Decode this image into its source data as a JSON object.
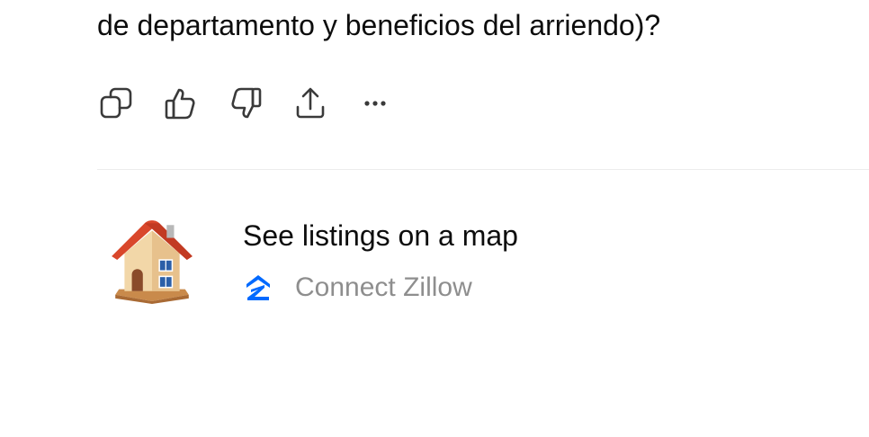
{
  "message": {
    "text": "de departamento y beneficios del arriendo)?"
  },
  "actions": [
    {
      "name": "copy",
      "icon": "copy-icon"
    },
    {
      "name": "thumbs-up",
      "icon": "thumbs-up-icon"
    },
    {
      "name": "thumbs-down",
      "icon": "thumbs-down-icon"
    },
    {
      "name": "share",
      "icon": "share-icon"
    },
    {
      "name": "more",
      "icon": "more-icon"
    }
  ],
  "card": {
    "icon": "house-icon",
    "title": "See listings on a map",
    "connect_label": "Connect Zillow",
    "connect_icon": "zillow-icon",
    "zillow_color": "#006AFF"
  }
}
